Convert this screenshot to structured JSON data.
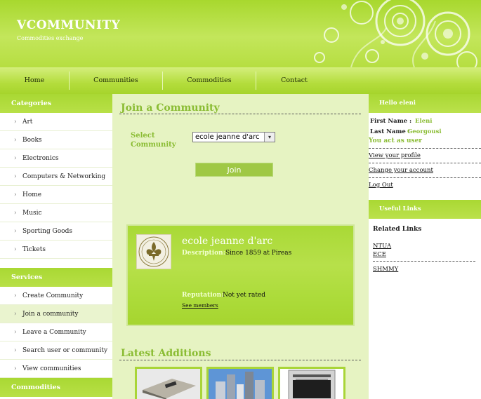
{
  "header": {
    "logo": "VCOMMUNITY",
    "slogan": "Commodities exchange"
  },
  "nav": {
    "items": [
      "Home",
      "Communities",
      "Commodities",
      "Contact"
    ]
  },
  "left_sidebar": {
    "categories_title": "Categories",
    "categories": [
      "Art",
      "Books",
      "Electronics",
      "Computers & Networking",
      "Home",
      "Music",
      "Sporting Goods",
      "Tickets"
    ],
    "services_title": "Services",
    "services": [
      "Create Community",
      "Join a community",
      "Leave a Community",
      "Search user or community",
      "View communities"
    ],
    "commodities_title": "Commodities"
  },
  "main": {
    "join_title": "Join a Community",
    "select_label": "Select Community",
    "select_value": "ecole jeanne d'arc",
    "join_button": "Join",
    "community": {
      "name": "ecole jeanne d'arc",
      "description_label": "Description:",
      "description": "Since 1859 at Pireas",
      "reputation_label": "Reputation:",
      "reputation": "Not yet rated",
      "see_members": "See members"
    },
    "latest_title": "Latest Additions"
  },
  "right_sidebar": {
    "hello_title": "Hello eleni",
    "first_name_label": "First Name :",
    "first_name": "Eleni",
    "last_name_label": "Last Name :",
    "last_name": "Georgousi",
    "role_text": "You act as user",
    "links": [
      "View your profile",
      "Change your account",
      "Log Out"
    ],
    "useful_links_title": "Useful Links",
    "related_title": "Related Links",
    "related_links": [
      "NTUA",
      "ECE",
      "SHMMY"
    ]
  },
  "colors": {
    "accent": "#a9d833",
    "accent_text": "#8abc33",
    "background": "#e6f3c2"
  }
}
